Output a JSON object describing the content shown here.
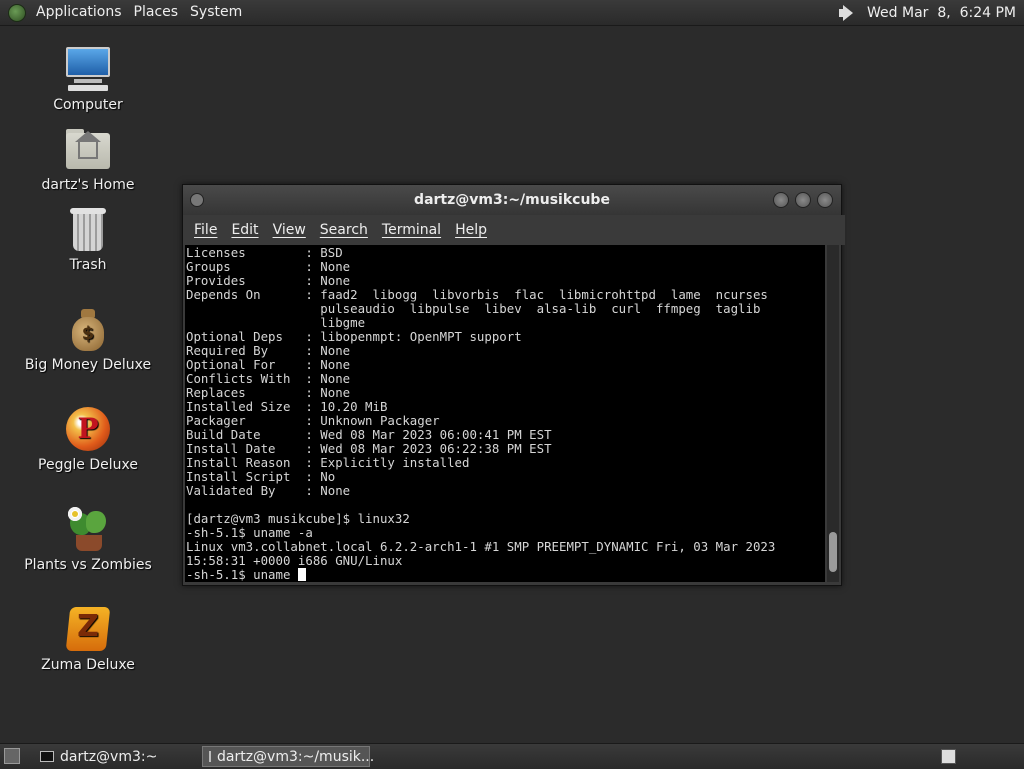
{
  "top_panel": {
    "menus": [
      "Applications",
      "Places",
      "System"
    ],
    "clock": "Wed Mar  8,  6:24 PM",
    "icons": {
      "gnome": "gnome-foot-icon",
      "volume": "volume-icon"
    }
  },
  "desktop": {
    "icons": [
      {
        "label": "Computer",
        "icon": "computer-icon"
      },
      {
        "label": "dartz's Home",
        "icon": "home-folder-icon"
      },
      {
        "label": "Trash",
        "icon": "trash-icon"
      },
      {
        "label": "Big Money Deluxe",
        "icon": "money-bag-icon"
      },
      {
        "label": "Peggle Deluxe",
        "icon": "peggle-icon"
      },
      {
        "label": "Plants vs Zombies",
        "icon": "plants-icon"
      },
      {
        "label": "Zuma Deluxe",
        "icon": "zuma-icon"
      }
    ]
  },
  "terminal": {
    "title": "dartz@vm3:~/musikcube",
    "menu": [
      "File",
      "Edit",
      "View",
      "Search",
      "Terminal",
      "Help"
    ],
    "lines": [
      "Licenses        : BSD",
      "Groups          : None",
      "Provides        : None",
      "Depends On      : faad2  libogg  libvorbis  flac  libmicrohttpd  lame  ncurses",
      "                  pulseaudio  libpulse  libev  alsa-lib  curl  ffmpeg  taglib",
      "                  libgme",
      "Optional Deps   : libopenmpt: OpenMPT support",
      "Required By     : None",
      "Optional For    : None",
      "Conflicts With  : None",
      "Replaces        : None",
      "Installed Size  : 10.20 MiB",
      "Packager        : Unknown Packager",
      "Build Date      : Wed 08 Mar 2023 06:00:41 PM EST",
      "Install Date    : Wed 08 Mar 2023 06:22:38 PM EST",
      "Install Reason  : Explicitly installed",
      "Install Script  : No",
      "Validated By    : None",
      "",
      "[dartz@vm3 musikcube]$ linux32",
      "-sh-5.1$ uname -a",
      "Linux vm3.collabnet.local 6.2.2-arch1-1 #1 SMP PREEMPT_DYNAMIC Fri, 03 Mar 2023",
      "15:58:31 +0000 i686 GNU/Linux"
    ],
    "prompt_line": "-sh-5.1$ uname "
  },
  "taskbar": {
    "tasks": [
      {
        "label": "dartz@vm3:~",
        "active": false
      },
      {
        "label": "dartz@vm3:~/musik...",
        "active": true
      }
    ]
  }
}
